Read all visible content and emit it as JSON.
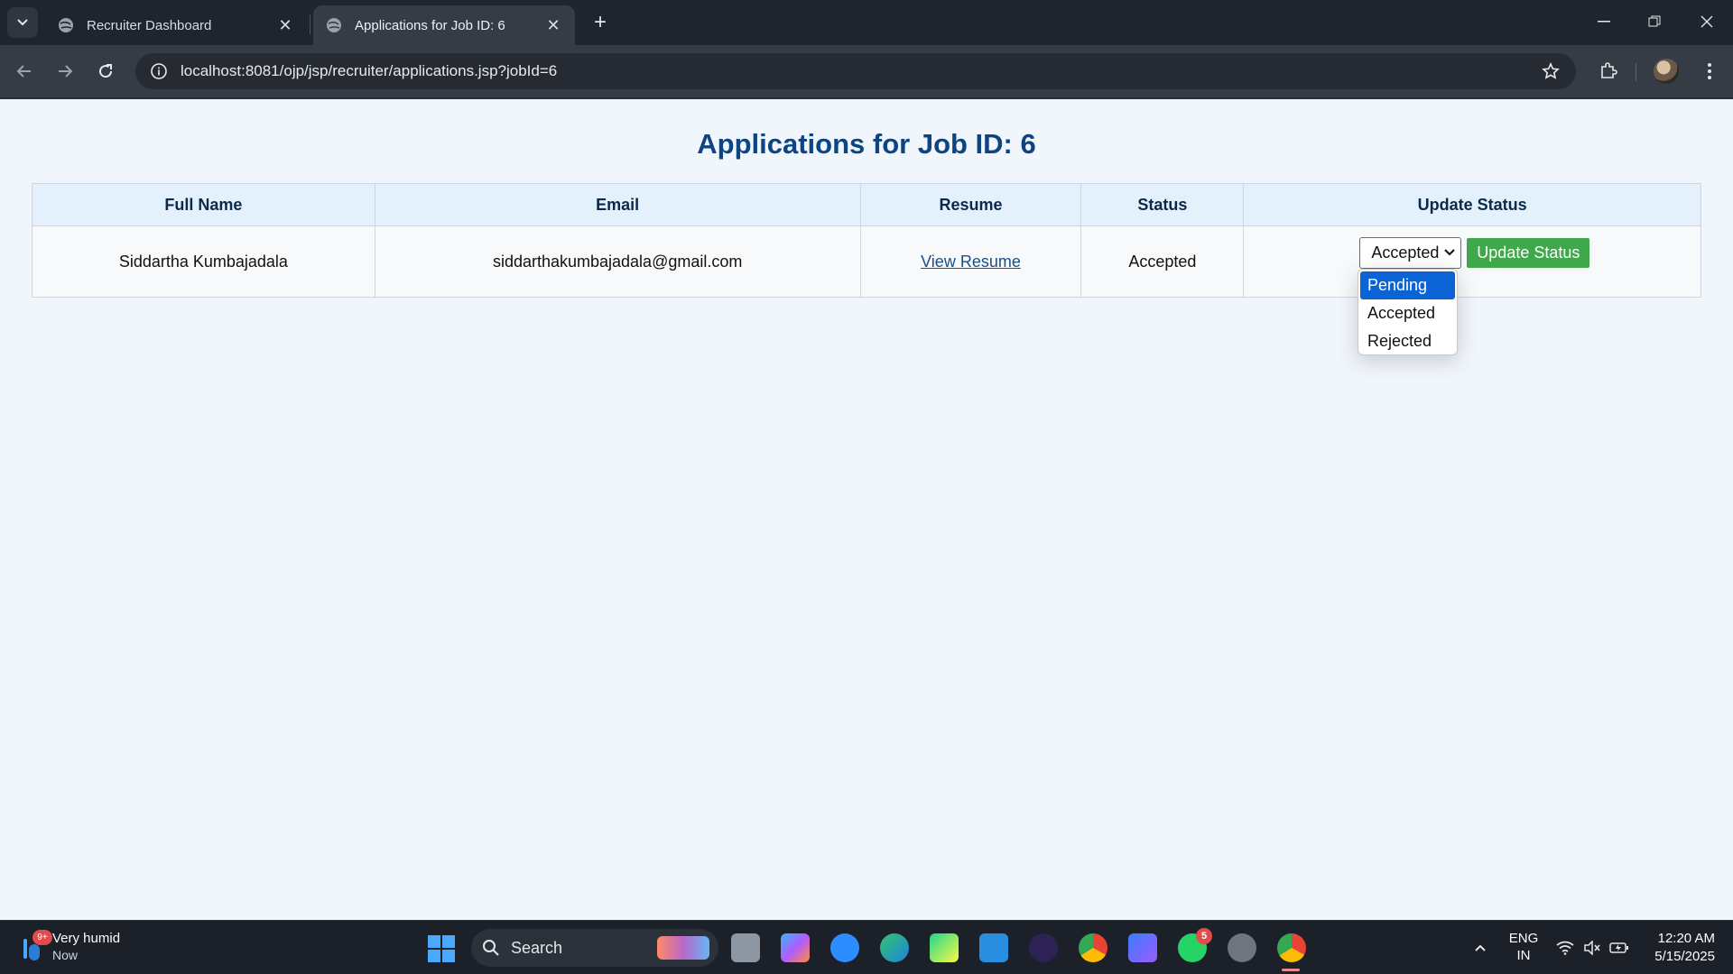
{
  "browser": {
    "tabs": [
      {
        "title": "Recruiter Dashboard",
        "active": false
      },
      {
        "title": "Applications for Job ID: 6",
        "active": true
      }
    ],
    "address": "localhost:8081/ojp/jsp/recruiter/applications.jsp?jobId=6"
  },
  "page": {
    "title": "Applications for Job ID: 6",
    "table": {
      "headers": [
        "Full Name",
        "Email",
        "Resume",
        "Status",
        "Update Status"
      ],
      "rows": [
        {
          "full_name": "Siddartha Kumbajadala",
          "email": "siddarthakumbajadala@gmail.com",
          "resume_link": "View Resume",
          "status": "Accepted",
          "select_value": "Accepted",
          "update_button": "Update Status"
        }
      ]
    },
    "dropdown": {
      "options": [
        "Pending",
        "Accepted",
        "Rejected"
      ],
      "highlighted": "Pending"
    }
  },
  "taskbar": {
    "weather": {
      "title": "Very humid",
      "subtitle": "Now",
      "badge": "9+"
    },
    "search_label": "Search",
    "whatsapp_badge": "5",
    "language": {
      "line1": "ENG",
      "line2": "IN"
    },
    "time": "12:20 AM",
    "date": "5/15/2025"
  },
  "colors": {
    "title": "#0c4582",
    "update_button": "#3ea84a",
    "dropdown_highlight": "#0b64d6"
  }
}
